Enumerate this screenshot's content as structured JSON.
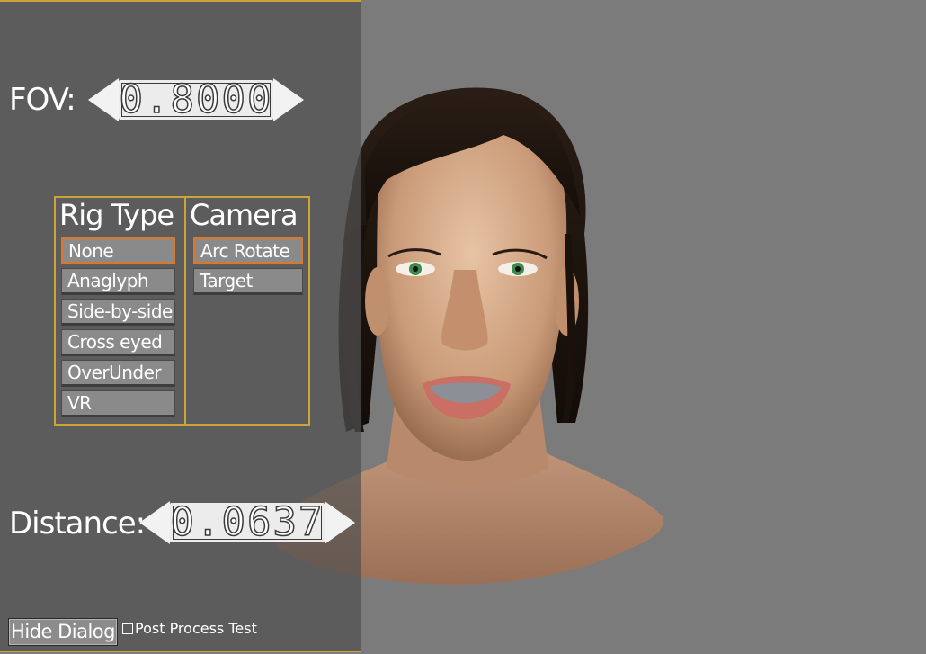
{
  "fov": {
    "label": "FOV:",
    "value": "0.8000"
  },
  "distance": {
    "label": "Distance:",
    "value": "0.0637"
  },
  "rig_type": {
    "title": "Rig Type",
    "options": [
      "None",
      "Anaglyph",
      "Side-by-side",
      "Cross eyed",
      "OverUnder",
      "VR"
    ],
    "selected": "None"
  },
  "camera": {
    "title": "Camera",
    "options": [
      "Arc Rotate",
      "Target"
    ],
    "selected": "Arc Rotate"
  },
  "footer": {
    "hide_dialog_label": "Hide Dialog",
    "post_process_label": "Post Process Test",
    "post_process_checked": false
  },
  "colors": {
    "background": "#7b7b7b",
    "panel_border": "#c9a43a",
    "selected_border": "#d9782a",
    "button_fill": "#8a8a8a"
  }
}
